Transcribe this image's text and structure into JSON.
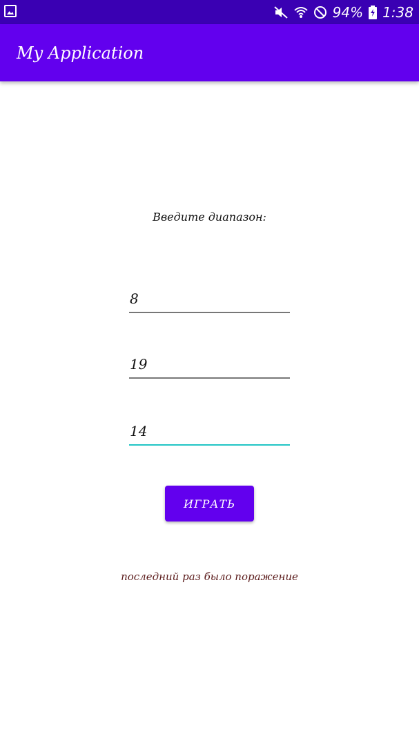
{
  "status_bar": {
    "battery": "94%",
    "time": "1:38",
    "icons": [
      "image-notification-icon",
      "mute-icon",
      "wifi-icon",
      "dnd-icon",
      "battery-icon"
    ]
  },
  "app_bar": {
    "title": "My Application"
  },
  "main": {
    "prompt": "Введите диапазон:",
    "fields": [
      {
        "value": "8"
      },
      {
        "value": "19"
      },
      {
        "value": "14"
      }
    ],
    "play_label": "ИГРАТЬ",
    "result_text": "последний раз было поражение"
  },
  "colors": {
    "status_bar": "#3a00b3",
    "app_bar": "#6200ee",
    "accent": "#20c5c5",
    "button": "#6200ee",
    "result_text": "#5a1a1a"
  }
}
